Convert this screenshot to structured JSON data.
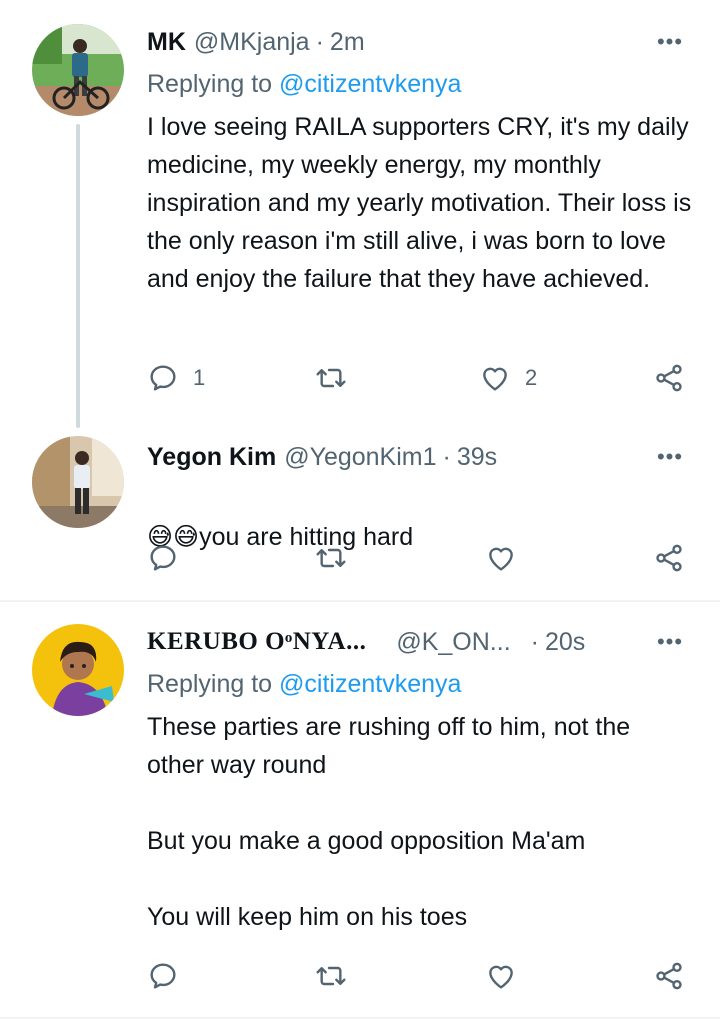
{
  "tweets": [
    {
      "name": "MK",
      "handle": "@MKjanja",
      "time": "2m",
      "replying_prefix": "Replying to ",
      "replying_to": "@citizentvkenya",
      "text": "I love seeing RAILA supporters CRY, it's my daily medicine, my weekly energy, my monthly inspiration and my yearly motivation. Their loss is the only reason i'm still alive, i was born to love and enjoy the failure that they have achieved.",
      "reply_count": "1",
      "like_count": "2"
    },
    {
      "name": "Yegon Kim",
      "handle": "@YegonKim1",
      "time": "39s",
      "emoji": "😅😅",
      "text": "you are hitting hard"
    },
    {
      "name": "KERUBO OᵒNYA...",
      "handle": "@K_ON...",
      "time": "20s",
      "replying_prefix": "Replying to ",
      "replying_to": "@citizentvkenya",
      "text": "These parties are rushing off to him, not the other way round\n\nBut you make a good opposition Ma'am\n\nYou will keep him on his toes"
    }
  ],
  "separator": "·",
  "more_label": "•••",
  "icons": {
    "reply": "reply-icon",
    "retweet": "retweet-icon",
    "like": "heart-icon",
    "share": "share-icon",
    "more": "more-icon"
  },
  "colors": {
    "link": "#1d9bf0",
    "secondary": "#536471",
    "text": "#0f1419",
    "thread_line": "#cfd9de",
    "divider": "#eff3f4"
  }
}
